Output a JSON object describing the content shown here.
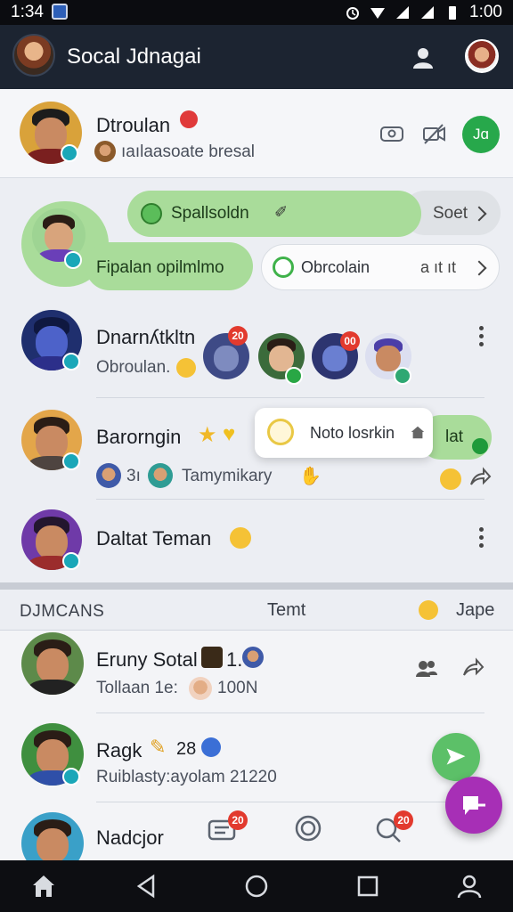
{
  "status_bar": {
    "time": "1:34",
    "right_time": "1:00"
  },
  "app_bar": {
    "title": "Socal Jdnagai"
  },
  "top_contact": {
    "name": "Dtroulan",
    "status": "ıaılaasoate bresal",
    "join_label": "Jɑ"
  },
  "bubbles": {
    "bubble1": {
      "text": "Spallsoldn",
      "action": "Soet"
    },
    "bubble2": {
      "text": "Fipalan opilmlmo"
    },
    "bubble3": {
      "text": "Obrcolain",
      "meta": "a ıt ıt"
    }
  },
  "chats": [
    {
      "name": "Dnarnʎtkltn",
      "subtitle": "Obroulan.",
      "badge_a": "20",
      "badge_b": "00"
    },
    {
      "name": "Barorngin",
      "subtitle": "Tamymikary",
      "inline_text": "3ı",
      "action": "lat"
    },
    {
      "name": "Daltat Teman"
    }
  ],
  "notice": {
    "text": "Noto losrkin"
  },
  "section": {
    "label": "DJMCANS",
    "tab1": "Temt",
    "tab2": "Jape"
  },
  "contacts": [
    {
      "name": "Eruny Sotal",
      "tag": "1.",
      "subtitle": "Tollaan 1e:",
      "value": "100Ν"
    },
    {
      "name": "Ragk",
      "tag": "28",
      "subtitle": "Ruiblasty:ayolam 21220"
    },
    {
      "name": "Nadcjor"
    }
  ],
  "bottom_badges": {
    "b1": "20",
    "b2": "20"
  },
  "colors": {
    "accent_green": "#27a84b",
    "bubble_green": "#a9dc9a",
    "fab_purple": "#a72fb6",
    "appbar": "#1c2431"
  }
}
